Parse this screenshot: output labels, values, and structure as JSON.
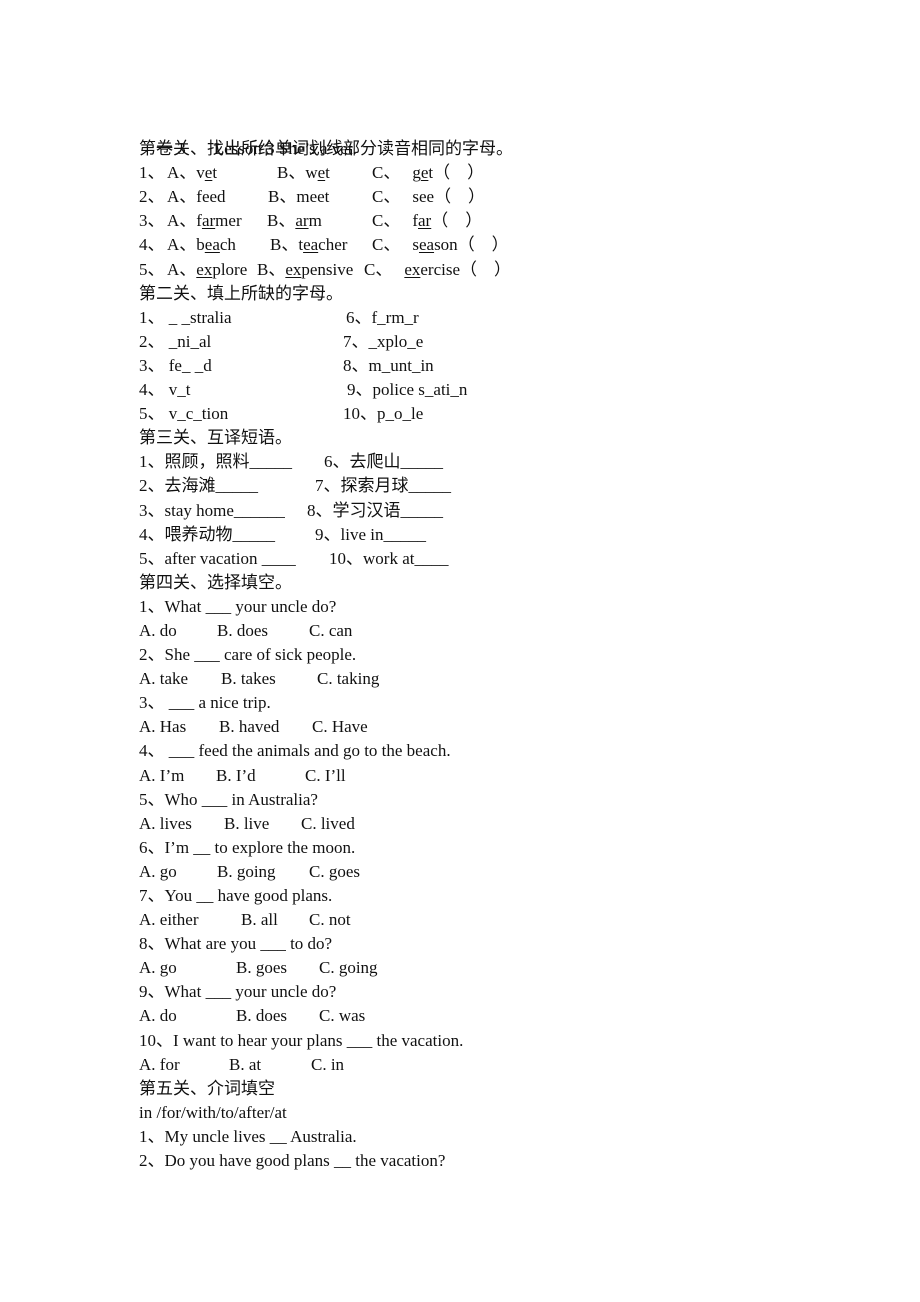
{
  "header": {
    "paper_no": "卷 3",
    "title": "Lesson 3 She’s a vet."
  },
  "section1": {
    "title": "第一关、找出所给单词划线部分读音相同的字母。",
    "items": [
      {
        "num": "1、",
        "a": [
          "A、",
          "v",
          "e",
          "t"
        ],
        "b": [
          "B、",
          "w",
          "e",
          "t"
        ],
        "c": [
          "C、",
          "g",
          "e",
          "t"
        ],
        "paren": "（    ）"
      },
      {
        "num": "2、",
        "a": [
          "A、",
          "",
          "",
          "feed"
        ],
        "b": [
          "B、",
          "",
          "",
          "meet"
        ],
        "c": [
          "C、",
          "",
          "",
          "see"
        ],
        "paren": "（    ）"
      },
      {
        "num": "3、",
        "a": [
          "A、",
          "f",
          "ar",
          "mer"
        ],
        "b": [
          "B、",
          "",
          "ar",
          "m"
        ],
        "c": [
          "C、",
          "f",
          "ar",
          ""
        ],
        "paren": "（    ）"
      },
      {
        "num": "4、",
        "a": [
          "A、",
          "b",
          "ea",
          "ch"
        ],
        "b": [
          "B、",
          "t",
          "ea",
          "cher"
        ],
        "c": [
          "C、",
          "s",
          "ea",
          "son"
        ],
        "paren": "（    ）"
      },
      {
        "num": "5、",
        "a": [
          "A、",
          "",
          "ex",
          "plore"
        ],
        "b": [
          "B、",
          "",
          "ex",
          "pensive"
        ],
        "c": [
          "C、",
          "",
          "ex",
          "ercise"
        ],
        "paren": "（    ）"
      }
    ]
  },
  "section2": {
    "title": "第二关、填上所缺的字母。",
    "left": [
      "1、 _ _stralia",
      "2、 _ni_al",
      "3、 fe_ _d",
      "4、 v_t",
      "5、 v_c_tion"
    ],
    "right": [
      "6、f_rm_r",
      "7、_xplo_e",
      "8、m_unt_in",
      "9、police s_ati_n",
      "10、p_o_le"
    ]
  },
  "section3": {
    "title": "第三关、互译短语。",
    "left": [
      "1、照顾，照料_____",
      "2、去海滩_____",
      "3、stay home______",
      "4、喂养动物_____",
      "5、after vacation ____"
    ],
    "right": [
      "6、去爬山_____",
      "7、探索月球_____",
      "8、学习汉语_____",
      "9、live in_____",
      "10、work at____"
    ]
  },
  "section4": {
    "title": "第四关、选择填空。",
    "questions": [
      {
        "q": "1、What ___ your uncle do?",
        "options": [
          "A. do",
          "B. does",
          "C. can"
        ]
      },
      {
        "q": "2、She ___ care of sick people.",
        "options": [
          "A. take",
          "B. takes",
          "C. taking"
        ]
      },
      {
        "q": "3、 ___ a nice trip.",
        "options": [
          "A. Has",
          "B. haved",
          "C. Have"
        ]
      },
      {
        "q": "4、 ___ feed the animals and go to the beach.",
        "options": [
          "A. I’m",
          "B. I’d",
          "C. I’ll"
        ]
      },
      {
        "q": "5、Who ___ in Australia?",
        "options": [
          "A. lives",
          "B. live",
          "C. lived"
        ]
      },
      {
        "q": "6、I’m __ to explore the moon.",
        "options": [
          "A. go",
          "B. going",
          "C. goes"
        ]
      },
      {
        "q": "7、You __ have good plans.",
        "options": [
          "A. either",
          "B. all",
          "C. not"
        ]
      },
      {
        "q": "8、What are you ___ to do?",
        "options": [
          "A. go",
          "B. goes",
          "C. going"
        ]
      },
      {
        "q": "9、What ___ your uncle do?",
        "options": [
          "A. do",
          "B. does",
          "C. was"
        ]
      },
      {
        "q": "10、I want to hear your plans ___ the vacation.",
        "options": [
          "A. for",
          "B. at",
          "C. in"
        ]
      }
    ]
  },
  "section5": {
    "title": "第五关、介词填空",
    "word_bank": "in /for/with/to/after/at",
    "items": [
      "1、My uncle lives __ Australia.",
      "2、Do you have good plans __ the vacation?"
    ]
  }
}
